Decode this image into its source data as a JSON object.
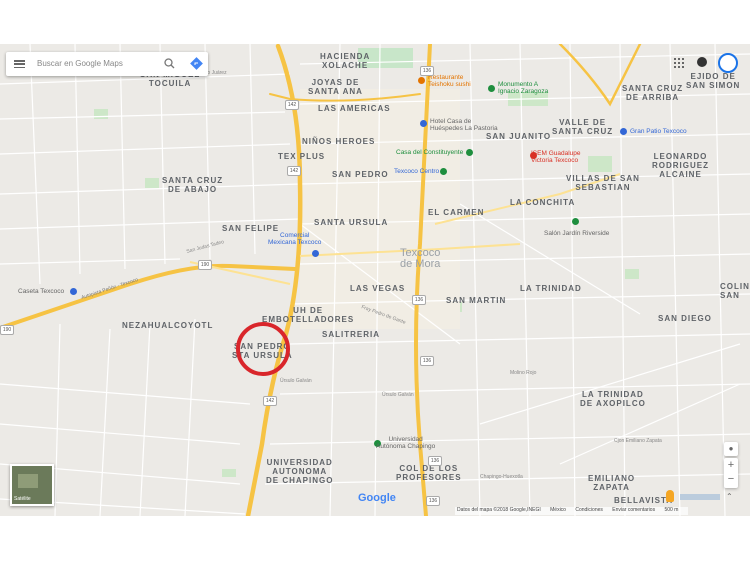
{
  "search": {
    "placeholder": "Buscar en Google Maps"
  },
  "satellite_label": "Satélite",
  "google_logo": "Google",
  "footer": {
    "data": "Datos del mapa ©2018 Google,INEGI",
    "country": "México",
    "terms": "Condiciones",
    "feedback": "Enviar comentarios",
    "scale": "500 m"
  },
  "zoom": {
    "in": "+",
    "out": "−"
  },
  "areas": {
    "hacienda_xolache": "HACIENDA\nXOLACHE",
    "san_miguel_tocuila": "SAN MIGUEL\nTOCUILA",
    "joyas_santa_ana": "JOYAS DE\nSANTA ANA",
    "las_americas": "LAS AMERICAS",
    "ninos_heroes": "NIÑOS HEROES",
    "tex_plus": "TEX PLUS",
    "san_pedro": "SAN PEDRO",
    "santa_cruz_abajo": "SANTA CRUZ\nDE ABAJO",
    "san_felipe": "SAN FELIPE",
    "santa_ursula": "SANTA URSULA",
    "el_carmen": "EL CARMEN",
    "la_conchita": "LA CONCHITA",
    "la_trinidad": "LA TRINIDAD",
    "san_martin": "SAN MARTIN",
    "las_vegas": "LAS VEGAS",
    "uh_embotelladores": "UH DE\nEMBOTELLADORES",
    "salitreria": "SALITRERIA",
    "nezahualcoyotl": "NEZAHUALCOYOTL",
    "san_pedro_santa_ursula": "SAN PEDRO\nSTA URSULA",
    "universidad_chapingo": "UNIVERSIDAD\nAUTONOMA\nDE CHAPINGO",
    "col_profesores": "COL DE LOS\nPROFESORES",
    "santa_cruz_arriba": "SANTA CRUZ\nDE ARRIBA",
    "ejido_san_simon": "EJIDO DE\nSAN SIMON",
    "valle_santa_cruz": "VALLE DE\nSANTA CRUZ",
    "san_juanito": "SAN JUANITO",
    "leonardo": "LEONARDO\nRODRIGUEZ\nALCAINE",
    "villas_san_sebastian": "VILLAS DE SAN\nSEBASTIAN",
    "san_diego": "SAN DIEGO",
    "colina": "COLIN\nSAN",
    "trinidad_axopilco": "LA TRINIDAD\nDE AXOPILCO",
    "emiliano_zapata": "EMILIANO\nZAPATA",
    "bellavista": "BELLAVISTA"
  },
  "city": "Texcoco\nde Mora",
  "pois": {
    "restaurante": "Restaurante\nTeishoku sushi",
    "monumento": "Monumento A\nIgnacio Zaragoza",
    "hotel": "Hotel Casa de\nHuéspedes La Pastoria",
    "casa_constituyente": "Casa del Constituyente",
    "texcoco_centro": "Texcoco Centro",
    "isem": "ISEM Guadalupe\nVictoria Texcoco",
    "gran_patio": "Gran Patio Texcoco",
    "comercial_mexicana": "Comercial\nMexicana Texcoco",
    "salon_jardin": "Salón Jardín Riverside",
    "caseta": "Caseta Texcoco",
    "universidad_poi": "Universidad\nAutónoma Chapingo"
  },
  "streets": {
    "autopista": "Autopista Peñón - Texcoco",
    "molino": "Molino Rojo",
    "ursulo1": "Úrsulo Galván",
    "ursulo2": "Úrsulo Galván",
    "chapingo": "Chapingo-Huexotla",
    "emiliano": "Cjon Emiliano Zapata",
    "fray": "Fray Pedro de Gante",
    "juarez": "Benito Juárez",
    "san_judas": "San Judas Tadeo"
  },
  "shields": [
    "142",
    "142",
    "190",
    "142",
    "136",
    "136",
    "136",
    "136",
    "136",
    "190"
  ]
}
